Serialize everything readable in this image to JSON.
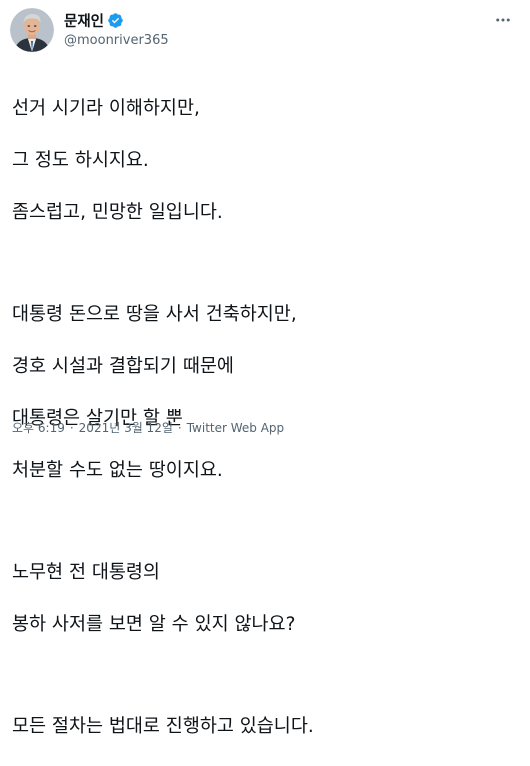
{
  "tweet": {
    "author": {
      "display_name": "문재인",
      "handle": "@moonriver365",
      "verified": true
    },
    "paragraphs": [
      [
        "선거 시기라 이해하지만,",
        "그 정도 하시지요.",
        "좀스럽고, 민망한 일입니다."
      ],
      [
        "대통령 돈으로 땅을 사서 건축하지만,",
        "경호 시설과 결합되기 때문에",
        "대통령은 살기만 할 뿐",
        "처분할 수도 없는 땅이지요."
      ],
      [
        "노무현 전 대통령의",
        "봉하 사저를 보면 알 수 있지 않나요?"
      ],
      [
        "모든 절차는 법대로 진행하고 있습니다."
      ]
    ],
    "meta": {
      "time": "오후 6:19",
      "date": "2021년 3월 12일",
      "separator": "·",
      "source": "Twitter Web App"
    }
  },
  "icons": {
    "more": "more-horizontal-icon",
    "verified": "verified-badge-icon"
  },
  "colors": {
    "text": "#0f1419",
    "secondary": "#536471",
    "verified_blue": "#1d9bf0"
  }
}
